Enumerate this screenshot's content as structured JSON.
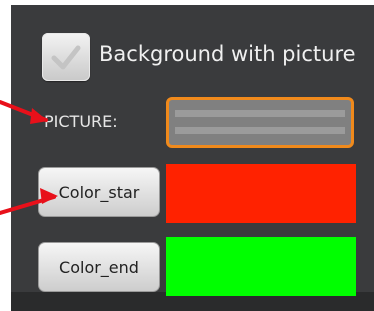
{
  "checkbox": {
    "label": "Background with picture",
    "checked": true,
    "icon": "checkmark-icon"
  },
  "picture": {
    "label": "PICTURE:",
    "value": ""
  },
  "color_start": {
    "button_label": "Color_star",
    "color": "#ff2200"
  },
  "color_end": {
    "button_label": "Color_end",
    "color": "#00ff00"
  },
  "colors": {
    "panel": "#3a3b3d",
    "focus_border": "#f08a1c",
    "arrow": "#e8101a"
  },
  "annotations": [
    {
      "icon": "red-arrow-icon",
      "points_to": "picture-field"
    },
    {
      "icon": "red-arrow-icon",
      "points_to": "color-start-button"
    }
  ]
}
